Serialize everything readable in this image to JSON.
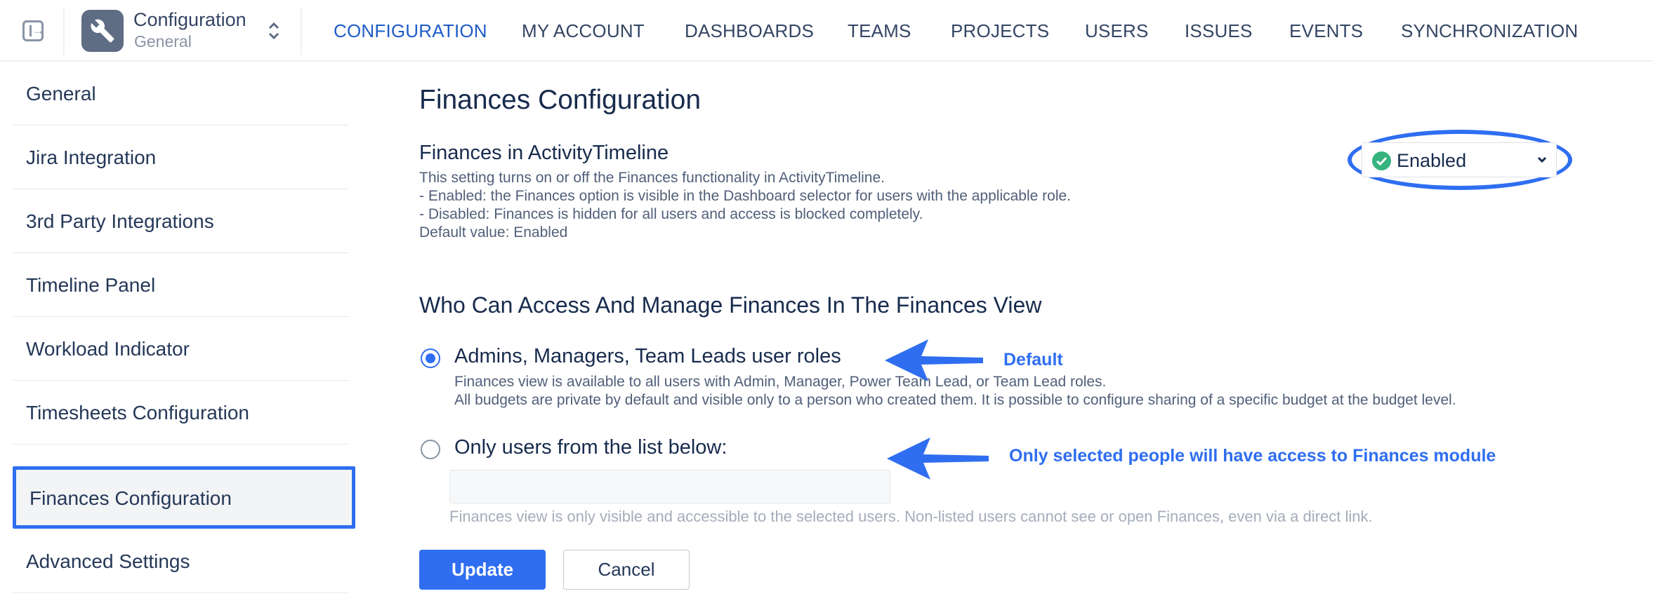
{
  "header": {
    "app_title": "Configuration",
    "app_subtitle": "General",
    "nav": [
      {
        "label": "CONFIGURATION",
        "active": true
      },
      {
        "label": "MY ACCOUNT"
      },
      {
        "label": "DASHBOARDS"
      },
      {
        "label": "TEAMS"
      },
      {
        "label": "PROJECTS"
      },
      {
        "label": "USERS"
      },
      {
        "label": "ISSUES"
      },
      {
        "label": "EVENTS"
      },
      {
        "label": "SYNCHRONIZATION"
      }
    ]
  },
  "sidebar": {
    "items": [
      {
        "label": "General"
      },
      {
        "label": "Jira Integration"
      },
      {
        "label": "3rd Party Integrations"
      },
      {
        "label": "Timeline Panel"
      },
      {
        "label": "Workload Indicator"
      },
      {
        "label": "Timesheets Configuration"
      },
      {
        "label": "Finances Configuration",
        "active": true
      },
      {
        "label": "Advanced Settings"
      }
    ]
  },
  "main": {
    "title": "Finances Configuration",
    "finances_setting": {
      "title": "Finances in ActivityTimeline",
      "description": [
        "This setting turns on or off the Finances functionality in ActivityTimeline.",
        "- Enabled: the Finances option is visible in the Dashboard selector for users with the applicable role.",
        "- Disabled: Finances is hidden for all users and access is blocked completely.",
        "Default value: Enabled"
      ],
      "selected_value": "Enabled"
    },
    "access_section": {
      "title": "Who Can Access And Manage Finances In The Finances View",
      "options": [
        {
          "label": "Admins, Managers, Team Leads user roles",
          "checked": true,
          "description": [
            "Finances view is available to all users with Admin, Manager, Power Team Lead, or Team Lead roles.",
            "All budgets are private by default and visible only to a person who created them. It is possible to configure sharing of a specific budget at the budget level."
          ]
        },
        {
          "label": "Only users from the list below:",
          "checked": false
        }
      ],
      "users_input_value": "",
      "hint": "Finances view is only visible and accessible to the selected users. Non-listed users cannot see or open Finances, even via a direct link."
    },
    "buttons": {
      "update": "Update",
      "cancel": "Cancel"
    }
  },
  "annotations": {
    "default_label": "Default",
    "selected_label": "Only selected people will have access to Finances module",
    "color": "#2f6ef0"
  },
  "colors": {
    "accent": "#2f6ef0",
    "nav_active": "#1e5cc8",
    "success": "#36b37e"
  }
}
